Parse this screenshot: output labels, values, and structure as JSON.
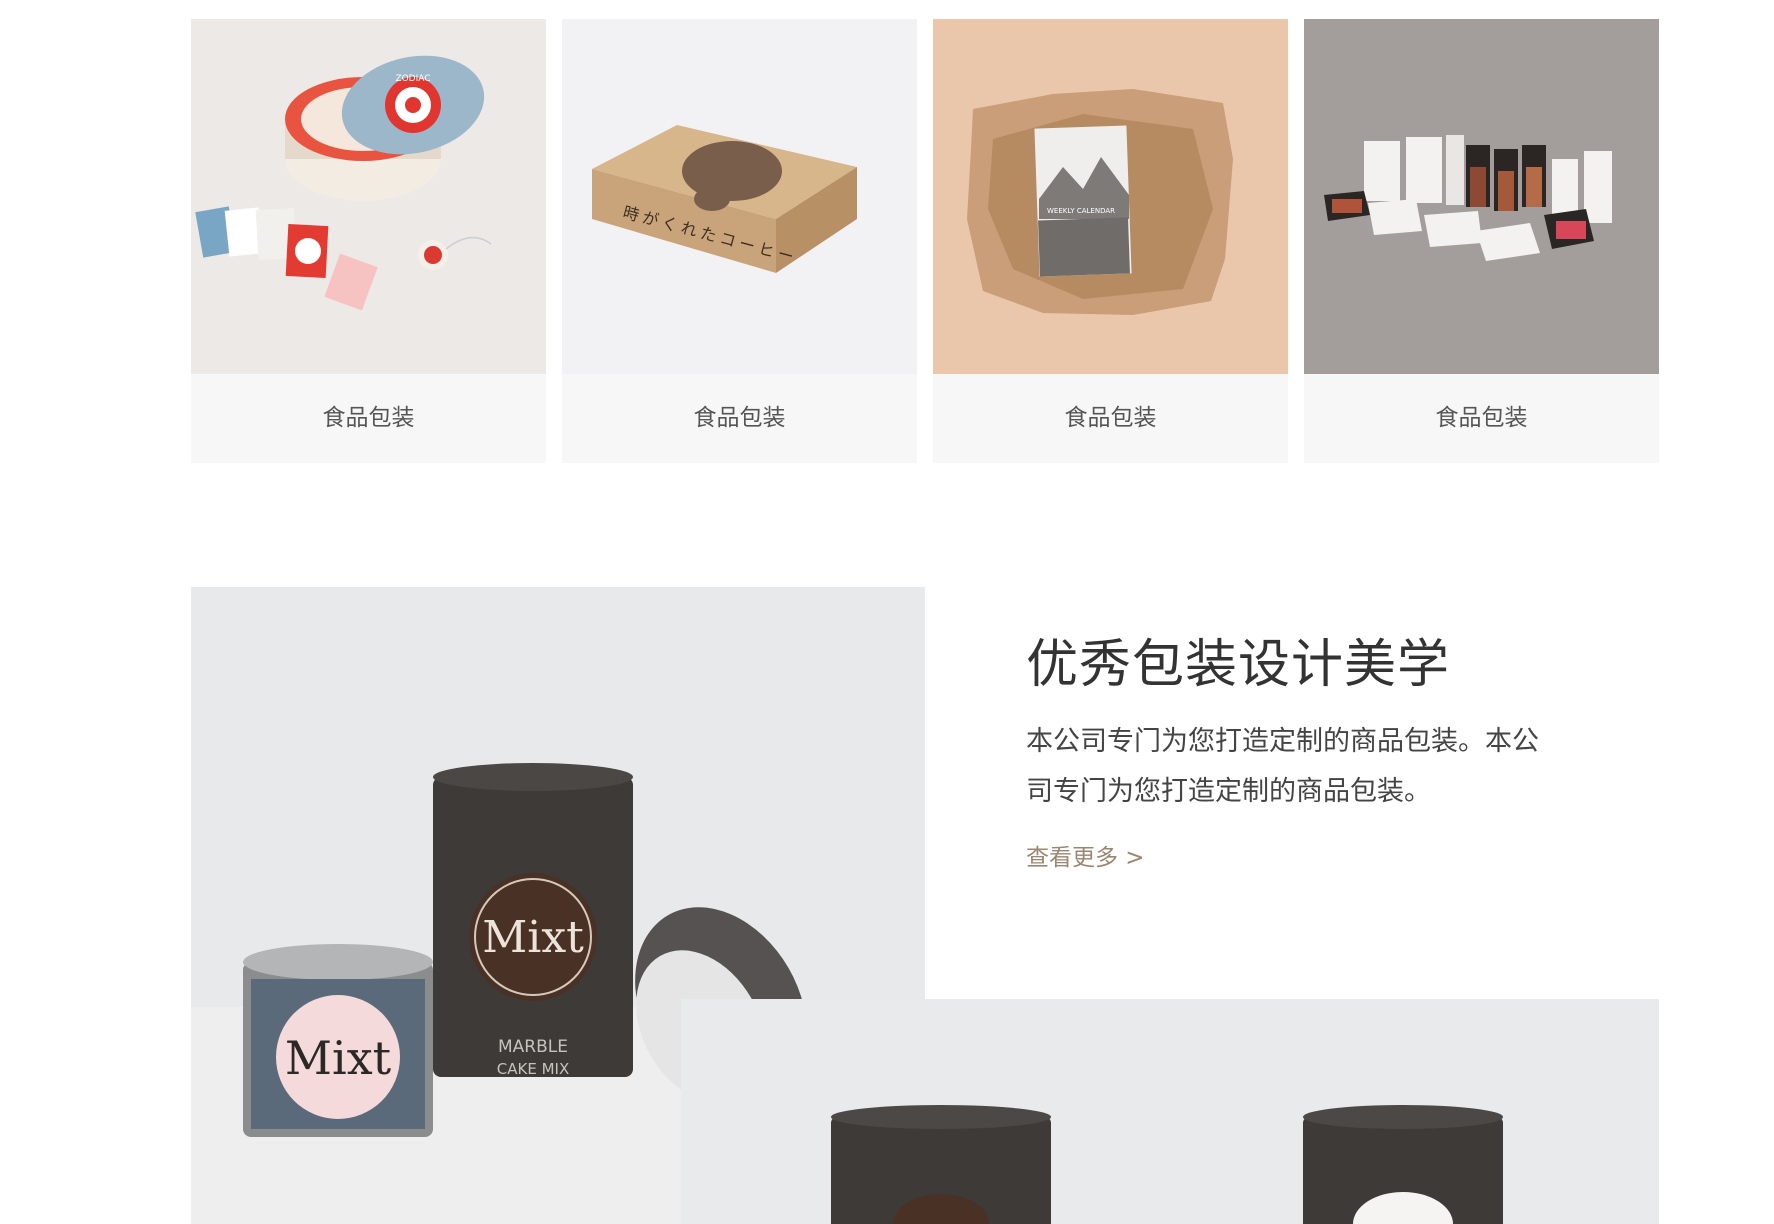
{
  "gallery": {
    "items": [
      {
        "caption": "食品包装",
        "image": "zodiac-tea-tin-packaging"
      },
      {
        "caption": "食品包装",
        "image": "kraft-coffee-box-packaging"
      },
      {
        "caption": "食品包装",
        "image": "calendar-paper-wrap-packaging"
      },
      {
        "caption": "食品包装",
        "image": "cosmetics-set-packaging"
      }
    ]
  },
  "feature": {
    "title": "优秀包装设计美学",
    "description": "本公司专门为您打造定制的商品包装。本公司专门为您打造定制的商品包装。",
    "more_link": "查看更多 >",
    "can_brand": "Mixt",
    "can_label_line1": "MARBLE",
    "can_label_line2": "CAKE MIX",
    "box_text": "時がくれたコーヒー",
    "calendar_text": "WEEKLY CALENDAR",
    "tin_text": "ZODIAC"
  },
  "colors": {
    "text": "#444444",
    "title": "#333333",
    "link": "#9c8572",
    "caption_bg": "#f7f7f7"
  }
}
